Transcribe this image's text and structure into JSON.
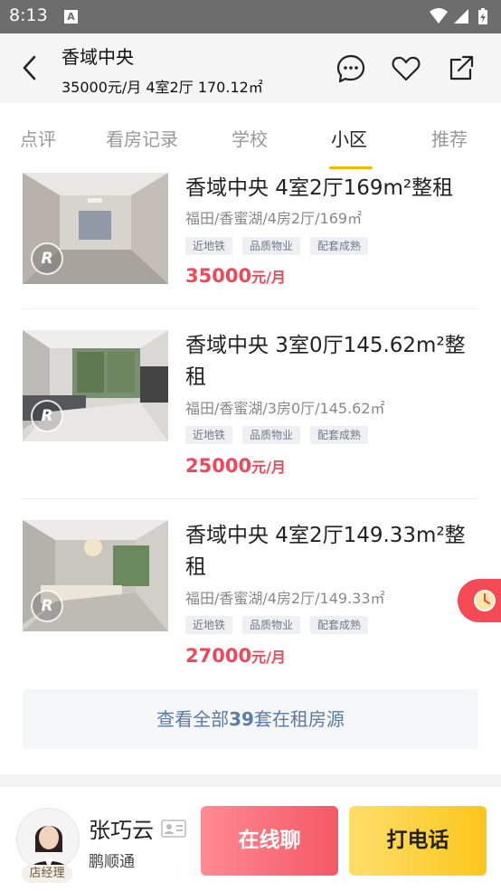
{
  "status_bar": {
    "time": "8:13",
    "notification_letter": "A"
  },
  "header": {
    "title": "香域中央",
    "subtitle": "35000元/月  4室2厅  170.12㎡",
    "icons": [
      "back-arrow-icon",
      "message-icon",
      "heart-icon",
      "share-icon"
    ]
  },
  "tabs": [
    {
      "label": "点评",
      "active": false
    },
    {
      "label": "看房记录",
      "active": false
    },
    {
      "label": "学校",
      "active": false
    },
    {
      "label": "小区",
      "active": true
    },
    {
      "label": "推荐",
      "active": false
    }
  ],
  "listings": [
    {
      "title": "香域中央 4室2厅169m²整租",
      "meta": "福田/香蜜湖/4房2厅/169㎡",
      "tags": [
        "近地铁",
        "品质物业",
        "配套成熟"
      ],
      "price": "35000",
      "price_unit": "元/月",
      "badge": "R"
    },
    {
      "title": "香域中央 3室0厅145.62m²整租",
      "meta": "福田/香蜜湖/3房0厅/145.62㎡",
      "tags": [
        "近地铁",
        "品质物业",
        "配套成熟"
      ],
      "price": "25000",
      "price_unit": "元/月",
      "badge": "R"
    },
    {
      "title": "香域中央 4室2厅149.33m²整租",
      "meta": "福田/香蜜湖/4房2厅/149.33㎡",
      "tags": [
        "近地铁",
        "品质物业",
        "配套成熟"
      ],
      "price": "27000",
      "price_unit": "元/月",
      "badge": "R"
    }
  ],
  "view_all": {
    "prefix": "查看全部",
    "count": "39",
    "suffix": "套在租房源"
  },
  "agent": {
    "name": "张巧云",
    "company": "鹏顺通",
    "role": "店经理",
    "chat_label": "在线聊",
    "call_label": "打电话"
  },
  "colors": {
    "price": "#f0485a",
    "tab_underline": "#f5b800",
    "chat": "#f45866",
    "call": "#fcc61c"
  }
}
